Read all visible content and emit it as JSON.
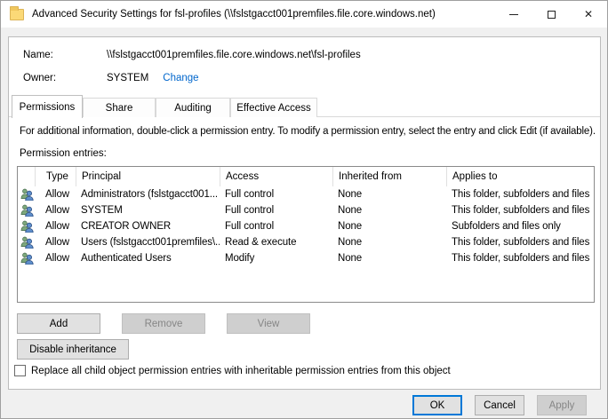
{
  "window": {
    "title": "Advanced Security Settings for fsl-profiles (\\\\fslstgacct001premfiles.file.core.windows.net)"
  },
  "properties": {
    "name_label": "Name:",
    "name_value": "\\\\fslstgacct001premfiles.file.core.windows.net\\fsl-profiles",
    "owner_label": "Owner:",
    "owner_value": "SYSTEM",
    "change_link": "Change"
  },
  "tabs": [
    {
      "label": "Permissions",
      "active": true
    },
    {
      "label": "Share",
      "active": false
    },
    {
      "label": "Auditing",
      "active": false
    },
    {
      "label": "Effective Access",
      "active": false
    }
  ],
  "info_text": "For additional information, double-click a permission entry. To modify a permission entry, select the entry and click Edit (if available).",
  "entries_label": "Permission entries:",
  "table": {
    "headers": [
      "Type",
      "Principal",
      "Access",
      "Inherited from",
      "Applies to"
    ],
    "rows": [
      {
        "icon": "users-icon",
        "type": "Allow",
        "principal": "Administrators (fslstgacct001...",
        "access": "Full control",
        "inherited_from": "None",
        "applies_to": "This folder, subfolders and files"
      },
      {
        "icon": "users-icon",
        "type": "Allow",
        "principal": "SYSTEM",
        "access": "Full control",
        "inherited_from": "None",
        "applies_to": "This folder, subfolders and files"
      },
      {
        "icon": "users-icon",
        "type": "Allow",
        "principal": "CREATOR OWNER",
        "access": "Full control",
        "inherited_from": "None",
        "applies_to": "Subfolders and files only"
      },
      {
        "icon": "users-icon",
        "type": "Allow",
        "principal": "Users (fslstgacct001premfiles\\...",
        "access": "Read & execute",
        "inherited_from": "None",
        "applies_to": "This folder, subfolders and files"
      },
      {
        "icon": "users-icon",
        "type": "Allow",
        "principal": "Authenticated Users",
        "access": "Modify",
        "inherited_from": "None",
        "applies_to": "This folder, subfolders and files"
      }
    ]
  },
  "buttons": {
    "add": "Add",
    "remove": "Remove",
    "view": "View",
    "disable_inheritance": "Disable inheritance",
    "ok": "OK",
    "cancel": "Cancel",
    "apply": "Apply"
  },
  "checkbox": {
    "checked": false,
    "label": "Replace all child object permission entries with inheritable permission entries from this object"
  },
  "colors": {
    "accent": "#0078d7",
    "link": "#0066cc",
    "folder_icon": "#fbd977"
  }
}
